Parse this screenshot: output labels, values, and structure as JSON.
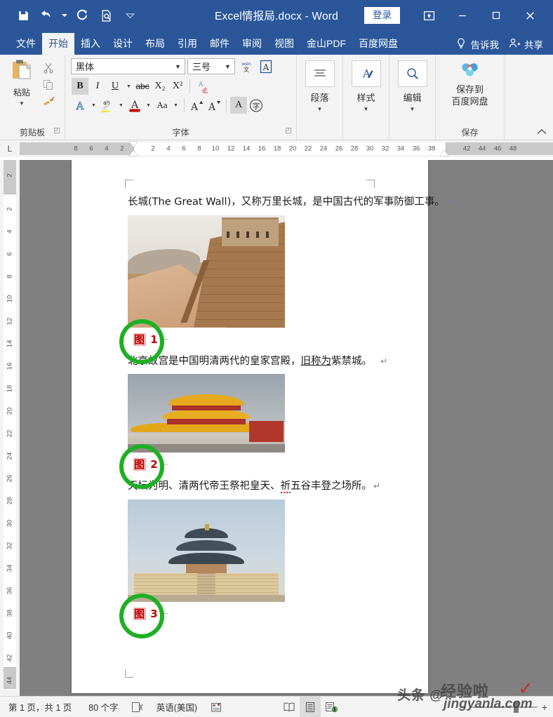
{
  "titlebar": {
    "document_title": "Excel情报局.docx  -  Word",
    "quick_access": [
      {
        "name": "save-icon",
        "tooltip": "保存"
      },
      {
        "name": "undo-icon",
        "tooltip": "撤销"
      },
      {
        "name": "redo-icon",
        "tooltip": "恢复"
      },
      {
        "name": "print-preview-icon",
        "tooltip": "打印预览"
      },
      {
        "name": "customize-qat-icon",
        "tooltip": "自定义快速访问工具栏"
      }
    ],
    "signin_label": "登录",
    "window_controls": [
      {
        "name": "ribbon-display-options-icon",
        "label": "功能区显示选项"
      },
      {
        "name": "minimize-icon",
        "label": "最小化"
      },
      {
        "name": "maximize-icon",
        "label": "最大化"
      },
      {
        "name": "close-icon",
        "label": "关闭"
      }
    ]
  },
  "tabs": [
    {
      "label": "文件",
      "active": false
    },
    {
      "label": "开始",
      "active": true
    },
    {
      "label": "插入",
      "active": false
    },
    {
      "label": "设计",
      "active": false
    },
    {
      "label": "布局",
      "active": false
    },
    {
      "label": "引用",
      "active": false
    },
    {
      "label": "邮件",
      "active": false
    },
    {
      "label": "审阅",
      "active": false
    },
    {
      "label": "视图",
      "active": false
    },
    {
      "label": "金山PDF",
      "active": false
    },
    {
      "label": "百度网盘",
      "active": false
    }
  ],
  "tellme_label": "告诉我",
  "share_label": "共享",
  "ribbon": {
    "clipboard": {
      "group_label": "剪贴板",
      "paste_label": "粘贴",
      "icons": [
        {
          "name": "cut-icon",
          "label": "剪切"
        },
        {
          "name": "copy-icon",
          "label": "复制"
        },
        {
          "name": "format-painter-icon",
          "label": "格式刷"
        }
      ]
    },
    "font": {
      "group_label": "字体",
      "font_name": "黑体",
      "font_size": "三号",
      "phonetic_guide_label": "拼音指南",
      "character_border_label": "字符边框",
      "buttons": [
        {
          "name": "bold-button",
          "label": "B",
          "active": true
        },
        {
          "name": "italic-button",
          "label": "I",
          "active": false
        },
        {
          "name": "underline-button",
          "label": "U",
          "active": false
        },
        {
          "name": "strikethrough-button",
          "label": "abc",
          "active": false
        },
        {
          "name": "subscript-button",
          "label": "X₂",
          "active": false
        },
        {
          "name": "superscript-button",
          "label": "X²",
          "active": false
        },
        {
          "name": "clear-formatting-button",
          "label": "清除格式",
          "active": false
        },
        {
          "name": "text-effects-button",
          "label": "A",
          "active": false
        },
        {
          "name": "text-highlight-button",
          "label": "ab",
          "active": false
        },
        {
          "name": "font-color-button",
          "label": "A",
          "active": false
        },
        {
          "name": "change-case-button",
          "label": "Aa",
          "active": false
        },
        {
          "name": "grow-font-button",
          "label": "A",
          "active": false
        },
        {
          "name": "shrink-font-button",
          "label": "A",
          "active": false
        },
        {
          "name": "character-shading-button",
          "label": "A",
          "active": false
        },
        {
          "name": "enclose-character-button",
          "label": "字",
          "active": false
        }
      ]
    },
    "paragraph": {
      "group_label": "段落",
      "button_label": "段落"
    },
    "styles": {
      "group_label": "样式",
      "button_label": "样式"
    },
    "editing": {
      "group_label": "编辑",
      "button_label": "编辑"
    },
    "save": {
      "group_label": "保存",
      "button_line1": "保存到",
      "button_line2": "百度网盘"
    },
    "collapse_label": "折叠功能区"
  },
  "ruler": {
    "tab_stop_marker": "L",
    "horizontal_ticks": [
      "8",
      "6",
      "4",
      "2",
      "2",
      "4",
      "6",
      "8",
      "10",
      "12",
      "14",
      "16",
      "18",
      "20",
      "22",
      "24",
      "26",
      "28",
      "30",
      "32",
      "34",
      "36",
      "38",
      "42",
      "44",
      "46",
      "48"
    ],
    "vertical_ticks": [
      "2",
      "2",
      "4",
      "6",
      "8",
      "10",
      "12",
      "14",
      "16",
      "18",
      "20",
      "22",
      "24",
      "26",
      "28",
      "30",
      "32",
      "34",
      "36",
      "38",
      "40",
      "42",
      "44"
    ]
  },
  "document": {
    "paragraphs": [
      {
        "id": "p1",
        "text": "长城(The Great Wall)，又称万里长城，是中国古代的军事防御工事。",
        "pilcrow": "↵"
      },
      {
        "id": "p2",
        "text_before": "北京故宫是中国明清两代的皇家宫殿，",
        "text_underlined": "旧称为",
        "text_after": "紫禁城。",
        "pilcrow": "↵"
      },
      {
        "id": "p3",
        "text_before": "天坛为明、清两代帝王祭祀皇天、",
        "text_spellerror": "祈",
        "text_after": "五谷丰登之场所。",
        "pilcrow": "↵"
      }
    ],
    "images": [
      {
        "name": "great-wall-photo",
        "alt": "长城"
      },
      {
        "name": "forbidden-city-photo",
        "alt": "北京故宫"
      },
      {
        "name": "temple-of-heaven-photo",
        "alt": "天坛"
      }
    ],
    "captions": [
      {
        "prefix": "图",
        "number": "1",
        "arrow": "←"
      },
      {
        "prefix": "图",
        "number": "2",
        "arrow": "←"
      },
      {
        "prefix": "图",
        "number": "3",
        "arrow": "←"
      }
    ],
    "annotation_color": "#1db024",
    "caption_color": "#c00000",
    "caption_highlight_color": "#f2b2b2"
  },
  "statusbar": {
    "page_info": "第 1 页，共 1 页",
    "word_count": "80 个字",
    "proofing_icon_label": "校对",
    "language": "英语(美国)",
    "macro_icon_label": "宏录制",
    "views": [
      {
        "name": "read-mode-icon",
        "label": "阅读视图",
        "selected": false
      },
      {
        "name": "print-layout-icon",
        "label": "页面视图",
        "selected": true
      },
      {
        "name": "web-layout-icon",
        "label": "Web 版式视图",
        "selected": false
      }
    ],
    "zoom_out_label": "−",
    "zoom_in_label": "+"
  },
  "watermark": {
    "line_a": "头条 @",
    "line_b": "经验啦",
    "line_c": "jingyanla.com",
    "check": "✓"
  }
}
